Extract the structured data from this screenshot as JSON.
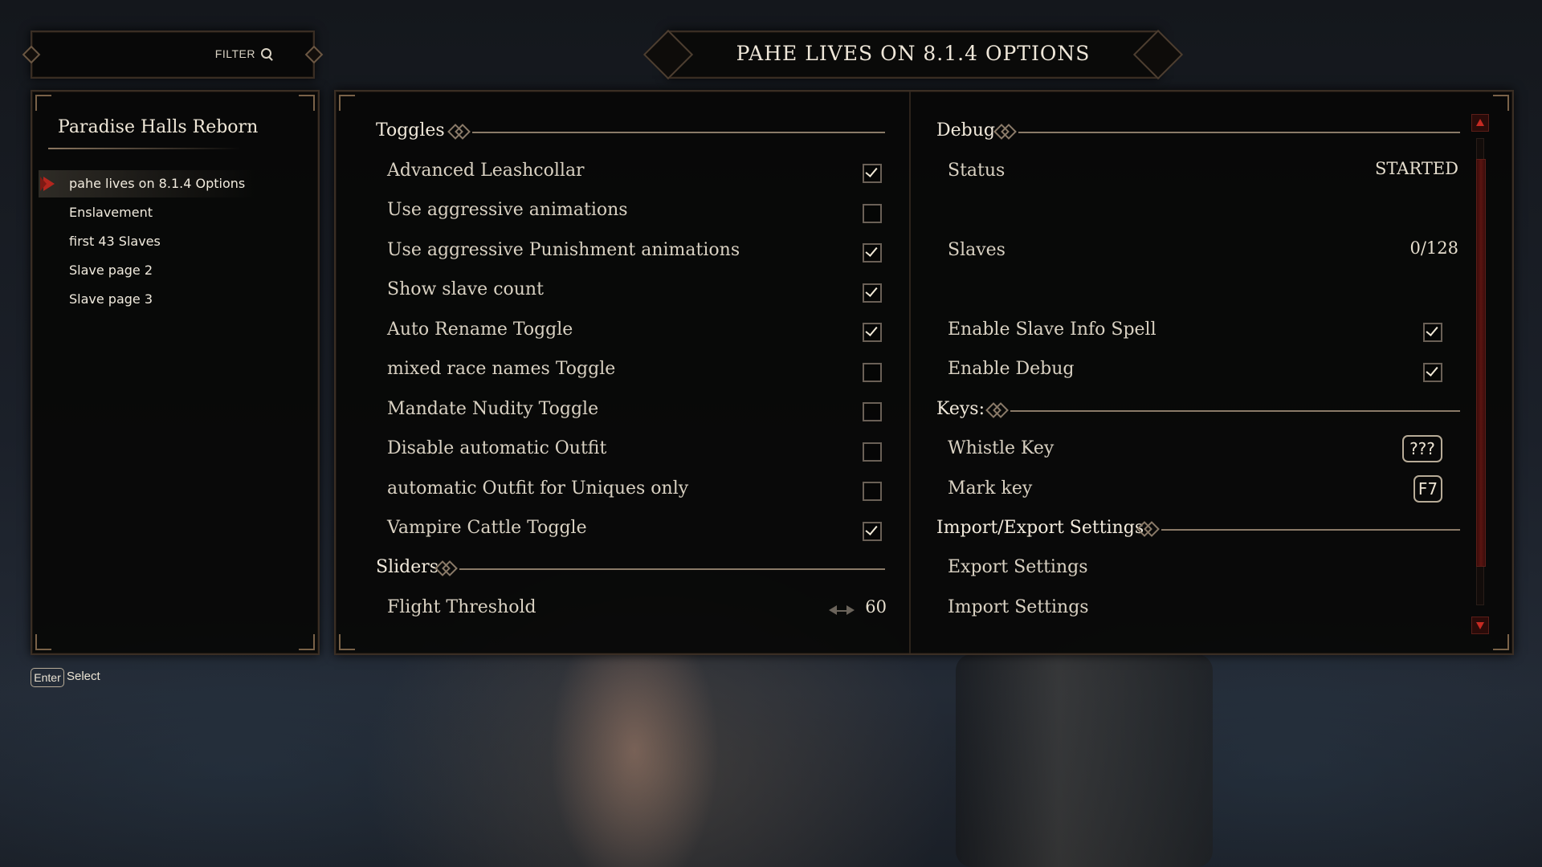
{
  "filter": {
    "label": "FILTER"
  },
  "title": "PAHE LIVES ON 8.1.4 OPTIONS",
  "sidebar": {
    "mod_name": "Paradise Halls Reborn",
    "items": [
      {
        "label": "pahe lives on 8.1.4 Options",
        "active": true
      },
      {
        "label": "Enslavement"
      },
      {
        "label": "first 43 Slaves"
      },
      {
        "label": "Slave page 2"
      },
      {
        "label": "Slave page 3"
      }
    ]
  },
  "left_column": {
    "toggles_header": "Toggles",
    "toggles": [
      {
        "label": "Advanced Leashcollar",
        "checked": true
      },
      {
        "label": "Use aggressive animations",
        "checked": false
      },
      {
        "label": "Use aggressive Punishment animations",
        "checked": true
      },
      {
        "label": "Show slave count",
        "checked": true
      },
      {
        "label": "Auto Rename Toggle",
        "checked": true
      },
      {
        "label": "mixed race names Toggle",
        "checked": false
      },
      {
        "label": "Mandate Nudity Toggle",
        "checked": false
      },
      {
        "label": "Disable automatic Outfit",
        "checked": false
      },
      {
        "label": "automatic Outfit for Uniques only",
        "checked": false
      },
      {
        "label": "Vampire Cattle Toggle",
        "checked": true
      }
    ],
    "sliders_header": "Sliders",
    "sliders": [
      {
        "label": "Flight Threshold",
        "value": "60"
      }
    ]
  },
  "right_column": {
    "debug_header": "Debug",
    "status_label": "Status",
    "status_value": "STARTED",
    "slaves_label": "Slaves",
    "slaves_value": "0/128",
    "toggles": [
      {
        "label": "Enable Slave Info Spell",
        "checked": true
      },
      {
        "label": "Enable Debug",
        "checked": true
      }
    ],
    "keys_header": "Keys:",
    "keys": [
      {
        "label": "Whistle Key",
        "key": "???"
      },
      {
        "label": "Mark key",
        "key": "F7"
      }
    ],
    "import_header": "Import/Export Settings",
    "export_label": "Export Settings",
    "import_label": "Import Settings"
  },
  "footer": {
    "key": "Enter",
    "action": "Select"
  }
}
